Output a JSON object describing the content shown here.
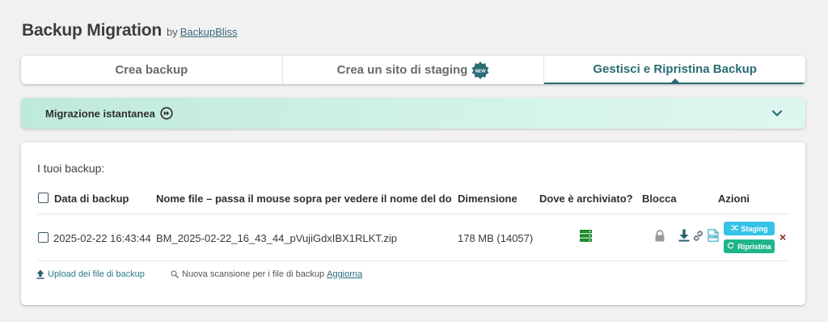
{
  "header": {
    "title": "Backup Migration",
    "by": "by",
    "brand": "BackupBliss"
  },
  "tabs": [
    {
      "label": "Crea backup",
      "active": false
    },
    {
      "label": "Crea un sito di staging",
      "badge": "NEW",
      "active": false
    },
    {
      "label": "Gestisci e Ripristina Backup",
      "active": true
    }
  ],
  "migration": {
    "label": "Migrazione istantanea"
  },
  "backups": {
    "title": "I tuoi backup:",
    "columns": {
      "date": "Data di backup",
      "filename": "Nome file – passa il mouse sopra per vedere il nome del do",
      "size": "Dimensione",
      "location": "Dove è archiviato?",
      "lock": "Blocca",
      "actions": "Azioni"
    },
    "rows": [
      {
        "date": "2025-02-22 16:43:44",
        "filename": "BM_2025-02-22_16_43_44_pVujiGdxIBX1RLKT.zip",
        "size": "178 MB (14057)",
        "staging_label": "Staging",
        "restore_label": "Ripristina",
        "delete_label": "×"
      }
    ],
    "footer": {
      "upload": "Upload dei file di backup",
      "rescan": "Nuova scansione per i file di backup",
      "refresh": "Aggiorna"
    }
  },
  "colors": {
    "accent": "#2a6c74",
    "staging": "#36c3e8",
    "restore": "#1fb58a",
    "server": "#1d8a2a",
    "delete": "#8a2a18"
  }
}
